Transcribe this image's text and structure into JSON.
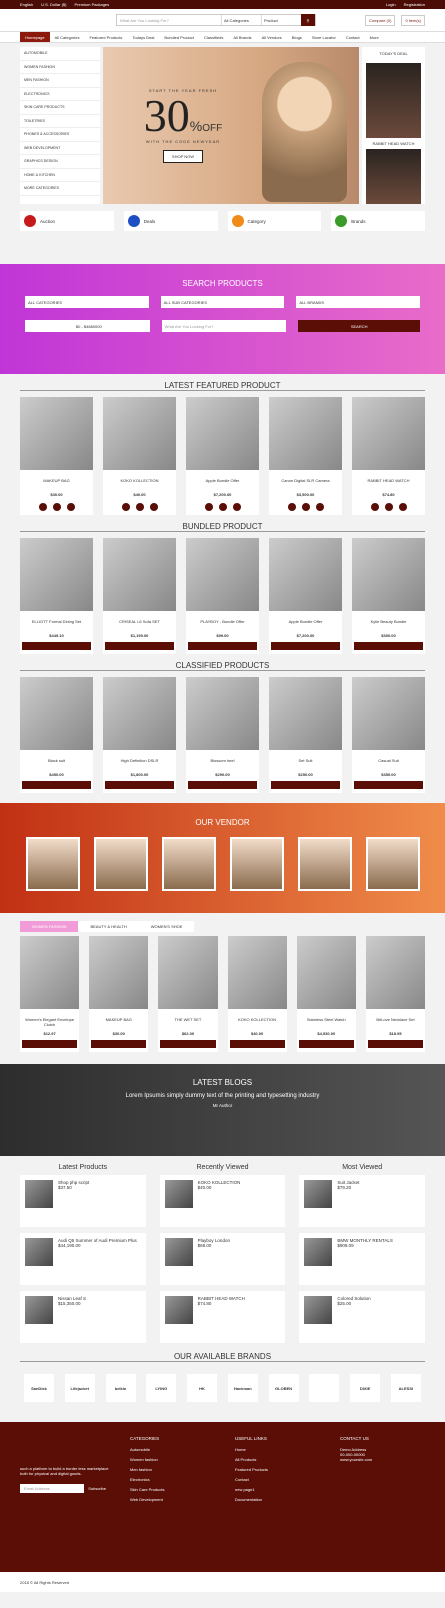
{
  "top": {
    "lang": "English",
    "currency": "U.S. Dollar ($)",
    "premium": "Premium Packages",
    "login": "Login",
    "register": "Registration"
  },
  "search": {
    "placeholder": "What Are You Looking For?",
    "cat": "All Categories",
    "type": "Product",
    "compare": "Compare (0)",
    "cart": "0 item(s)"
  },
  "nav": [
    "Homepage",
    "All Categories",
    "Featured Products",
    "Todays Deal",
    "Bundled Product",
    "Classifieds",
    "All Brands",
    "All Vendors",
    "Blogs",
    "Store Locator",
    "Contact",
    "More"
  ],
  "cats": [
    "AUTOMOBILE",
    "WOMEN FASHION",
    "MEN FASHION",
    "ELECTRONICS",
    "SKIN CARE PRODUCTS",
    "TOILETRIES",
    "PHONES & ACCESSORIES",
    "WEB DEVELOPMENT",
    "GRAPHICS DESIGN",
    "HOME & KITCHEN",
    "MORE CATEGORIES"
  ],
  "hero": {
    "line1": "START THE YEAR FRESH",
    "pct": "30",
    "off": "OFF",
    "code": "WITH THE CODE NEWYEAR",
    "btn": "SHOP NOW"
  },
  "today": {
    "title": "TODAY'S DEAL",
    "item": "RABBIT HEAD WATCH"
  },
  "features": [
    "Auction",
    "Deals",
    "Category",
    "Brands"
  ],
  "searchband": {
    "title": "SEARCH PRODUCTS",
    "cat": "ALL CATEGORIES",
    "sub": "ALL SUB CATEGORIES",
    "brand": "ALL BRANDS",
    "range": "$0 - $4880000",
    "q": "What Are You Looking For?",
    "btn": "SEARCH"
  },
  "featured": {
    "title": "LATEST FEATURED PRODUCT",
    "items": [
      [
        "MAKEUP BAG",
        "$30.00"
      ],
      [
        "KOKO KOLLECTION",
        "$40.00"
      ],
      [
        "Apple Bundle Offer",
        "$7,200.00"
      ],
      [
        "Canon Digital SLR Camera",
        "$3,500.00"
      ],
      [
        "RABBIT HEAD WATCH",
        "$74.80"
      ]
    ]
  },
  "bundled": {
    "title": "BUNDLED PRODUCT",
    "items": [
      [
        "ELLIOTT Formal Dining Set",
        "$449.10"
      ],
      [
        "CRISEAL l-6 Sofa SET",
        "$1,199.00"
      ],
      [
        "PLAYBOY - Bundle Offer",
        "$99.00"
      ],
      [
        "Apple Bundle Offer",
        "$7,200.00"
      ],
      [
        "Kylie Beauty Bundle",
        "$300.00"
      ]
    ]
  },
  "classified": {
    "title": "CLASSIFIED PRODUCTS",
    "items": [
      [
        "Black suit",
        "$450.00"
      ],
      [
        "High Definition DSLR",
        "$1,800.00"
      ],
      [
        "Blossom heel",
        "$290.00"
      ],
      [
        "Set Suit",
        "$250.00"
      ],
      [
        "Casual Suit",
        "$350.00"
      ]
    ]
  },
  "vendor": {
    "title": "OUR VENDOR"
  },
  "tabs": [
    "WOMEN FASHION",
    "BEAUTY & HEALTH",
    "WOMEN'S SHOE"
  ],
  "tabitems": [
    [
      "Women's Elegant Envelope Clutch",
      "$12.97"
    ],
    [
      "MAKEUP BAG",
      "$30.00"
    ],
    [
      "THE WET SET",
      "$62.00"
    ],
    [
      "KOKO KOLLECTION",
      "$40.00"
    ],
    [
      "Stainless Steel Watch",
      "$4,530.00"
    ],
    [
      "BriLove Necklace Set",
      "$18.95"
    ]
  ],
  "blogs": {
    "title": "LATEST BLOGS",
    "text": "Lorem Ipsumis simply dummy text of the printing and typesetting industry",
    "author": "Mr Author"
  },
  "latest": {
    "title": "Latest Products",
    "items": [
      [
        "Shop php script",
        "$37.50"
      ],
      [
        "Audi Q5 Summer of Audi Premium Plus",
        "$44,190.00"
      ],
      [
        "Nissan Leaf S",
        "$15,350.00"
      ]
    ]
  },
  "recent": {
    "title": "Recently Viewed",
    "items": [
      [
        "KOKO KOLLECTION",
        "$40.00"
      ],
      [
        "Playboy London",
        "$68.00"
      ],
      [
        "RABBIT HEAD WATCH",
        "$74.80"
      ]
    ]
  },
  "most": {
    "title": "Most Viewed",
    "items": [
      [
        "Suit Jacket",
        "$79.20"
      ],
      [
        "BMW MONTHLY RENTALS",
        "$909.09"
      ],
      [
        "Colored Solution",
        "$25.00"
      ]
    ]
  },
  "brandsTitle": "OUR AVAILABLE BRANDS",
  "brands": [
    "SanDisk",
    "Lifejacket",
    "belkin",
    "LYING",
    "HK",
    "Hackman",
    "GLOBEN",
    "",
    "DIXIE",
    "ALESSI"
  ],
  "footer": {
    "about": "such a platform to build a border less marketplace both for physical and digital goods.",
    "email": "Email Address",
    "subscribe": "Subscribe",
    "cat": "CATEGORIES",
    "cats": [
      "Automobile",
      "Women fashion",
      "Men fashion",
      "Electronics",
      "Skin Care Products",
      "Web Development"
    ],
    "links": "USEFUL LINKS",
    "linkItems": [
      "Home",
      "All Products",
      "Featured Products",
      "Contact",
      "new page1",
      "Documentation"
    ],
    "contact": "CONTACT US",
    "address": "Demo Address",
    "phone": "00-000-00000",
    "web": "www.yoursite.com"
  },
  "copyright": "2018 © All Rights Reserved"
}
